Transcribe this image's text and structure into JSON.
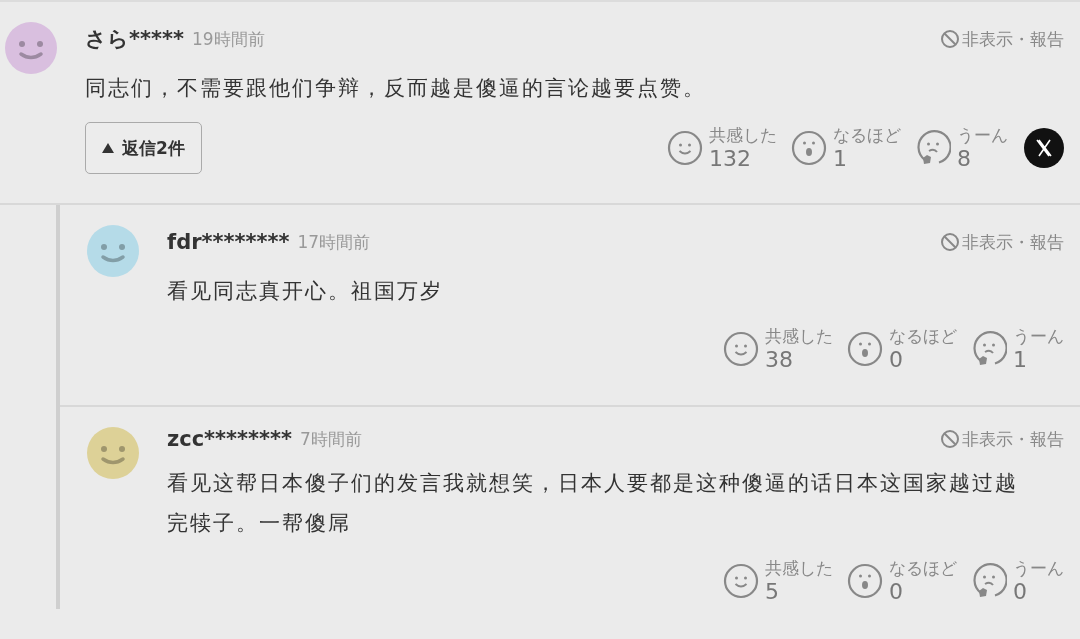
{
  "comment": {
    "user": "さら*****",
    "time": "19時間前",
    "color": "#d9bfdf",
    "hide_report": "非表示・報告",
    "text": "同志们，不需要跟他们争辩，反而越是傻逼的言论越要点赞。",
    "replies_toggle": {
      "label": "返信2件",
      "expanded": true
    },
    "reactions": [
      {
        "kind": "empathy",
        "label": "共感した",
        "count": "132"
      },
      {
        "kind": "insight",
        "label": "なるほど",
        "count": "1"
      },
      {
        "kind": "hmm",
        "label": "うーん",
        "count": "8"
      }
    ]
  },
  "replies": [
    {
      "user": "fdr********",
      "time": "17時間前",
      "color": "#b5dbe8",
      "hide_report": "非表示・報告",
      "text": "看见同志真开心。祖国万岁",
      "reactions": [
        {
          "kind": "empathy",
          "label": "共感した",
          "count": "38"
        },
        {
          "kind": "insight",
          "label": "なるほど",
          "count": "0"
        },
        {
          "kind": "hmm",
          "label": "うーん",
          "count": "1"
        }
      ]
    },
    {
      "user": "zcc********",
      "time": "7時間前",
      "color": "#ddd197",
      "hide_report": "非表示・報告",
      "text": "看见这帮日本傻子们的发言我就想笑，日本人要都是这种傻逼的话日本这国家越过越完犊子。一帮傻屌",
      "reactions": [
        {
          "kind": "empathy",
          "label": "共感した",
          "count": "5"
        },
        {
          "kind": "insight",
          "label": "なるほど",
          "count": "0"
        },
        {
          "kind": "hmm",
          "label": "うーん",
          "count": "0"
        }
      ]
    }
  ]
}
